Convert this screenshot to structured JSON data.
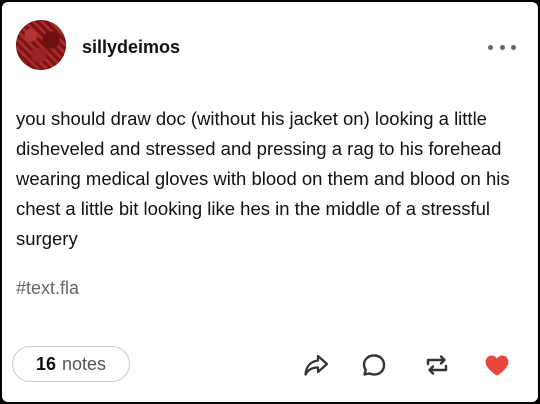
{
  "post": {
    "username": "sillydeimos",
    "body": "you should draw doc (without his jacket on) looking a little disheveled and stressed and pressing a rag to his forehead wearing medical gloves with blood on them and blood on his chest a little bit looking like hes in the middle of a stressful surgery",
    "tag": "#text.fla"
  },
  "footer": {
    "notes_count": "16",
    "notes_label": "notes"
  },
  "icons": {
    "share": "share-icon",
    "reply": "reply-icon",
    "reblog": "reblog-icon",
    "like": "heart-icon",
    "more": "more-options-icon"
  },
  "colors": {
    "like": "#e8463b",
    "icon": "#333333",
    "tag": "#666666"
  }
}
